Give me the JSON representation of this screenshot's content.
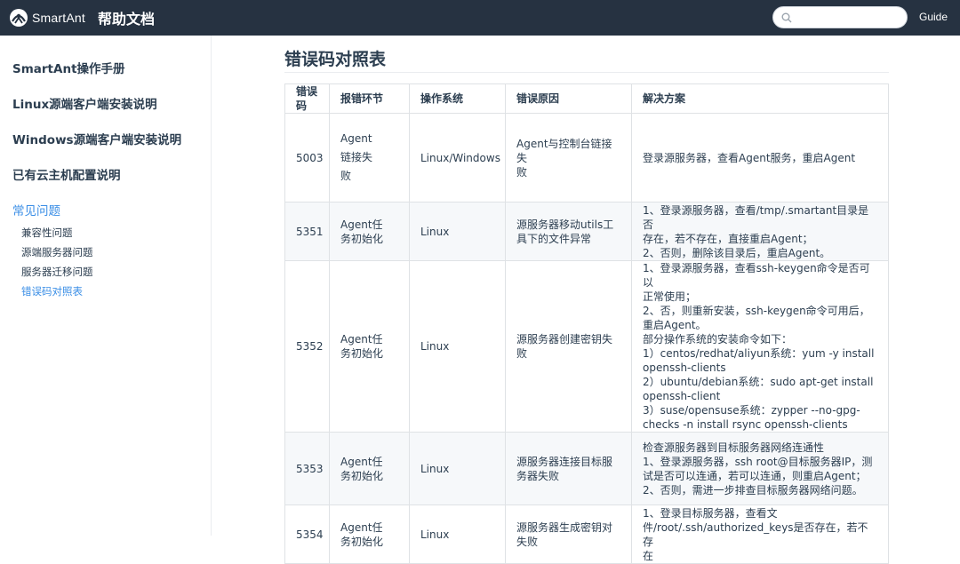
{
  "header": {
    "logo_text": "SmartAnt",
    "site_title": "帮助文档",
    "search": {
      "value": "",
      "placeholder": ""
    },
    "nav_guide": "Guide"
  },
  "sidebar": {
    "groups": [
      {
        "label": "SmartAnt操作手册"
      },
      {
        "label": "Linux源端客户端安装说明"
      },
      {
        "label": "Windows源端客户端安装说明"
      },
      {
        "label": "已有云主机配置说明"
      },
      {
        "label": "常见问题"
      }
    ],
    "sub_items": [
      {
        "label": "兼容性问题"
      },
      {
        "label": "源端服务器问题"
      },
      {
        "label": "服务器迁移问题"
      },
      {
        "label": "错误码对照表"
      }
    ]
  },
  "main": {
    "title": "错误码对照表",
    "table": {
      "headers": [
        "错误码",
        "报错环节",
        "操作系统",
        "错误原因",
        "解决方案"
      ],
      "rows": [
        {
          "code": "5003",
          "stage": "Agent\n链接失\n败",
          "os": "Linux/Windows",
          "cause": "Agent与控制台链接失\n败",
          "solution": "登录源服务器，查看Agent服务，重启Agent"
        },
        {
          "code": "5351",
          "stage": "Agent任\n务初始化",
          "os": "Linux",
          "cause": "源服务器移动utils工\n具下的文件异常",
          "solution": "1、登录源服务器，查看/tmp/.smartant目录是否\n存在，若不存在，直接重启Agent；\n2、否则，删除该目录后，重启Agent。"
        },
        {
          "code": "5352",
          "stage": "Agent任\n务初始化",
          "os": "Linux",
          "cause": "源服务器创建密钥失\n败",
          "solution": "1、登录源服务器，查看ssh-keygen命令是否可以\n正常使用；\n2、否，则重新安装，ssh-keygen命令可用后，\n重启Agent。\n部分操作系统的安装命令如下：\n1）centos/redhat/aliyun系统：yum -y install\nopenssh-clients\n2）ubuntu/debian系统：sudo apt-get install\nopenssh-client\n3）suse/opensuse系统：zypper --no-gpg-\nchecks -n install rsync openssh-clients"
        },
        {
          "code": "5353",
          "stage": "Agent任\n务初始化",
          "os": "Linux",
          "cause": "源服务器连接目标服\n务器失败",
          "solution": "检查源服务器到目标服务器网络连通性\n1、登录源服务器，ssh root@目标服务器IP，测\n试是否可以连通，若可以连通，则重启Agent；\n2、否则，需进一步排查目标服务器网络问题。"
        },
        {
          "code": "5354",
          "stage": "Agent任\n务初始化",
          "os": "Linux",
          "cause": "源服务器生成密钥对\n失败",
          "solution": "1、登录目标服务器，查看文\n件/root/.ssh/authorized_keys是否存在，若不存\n在"
        }
      ]
    }
  }
}
